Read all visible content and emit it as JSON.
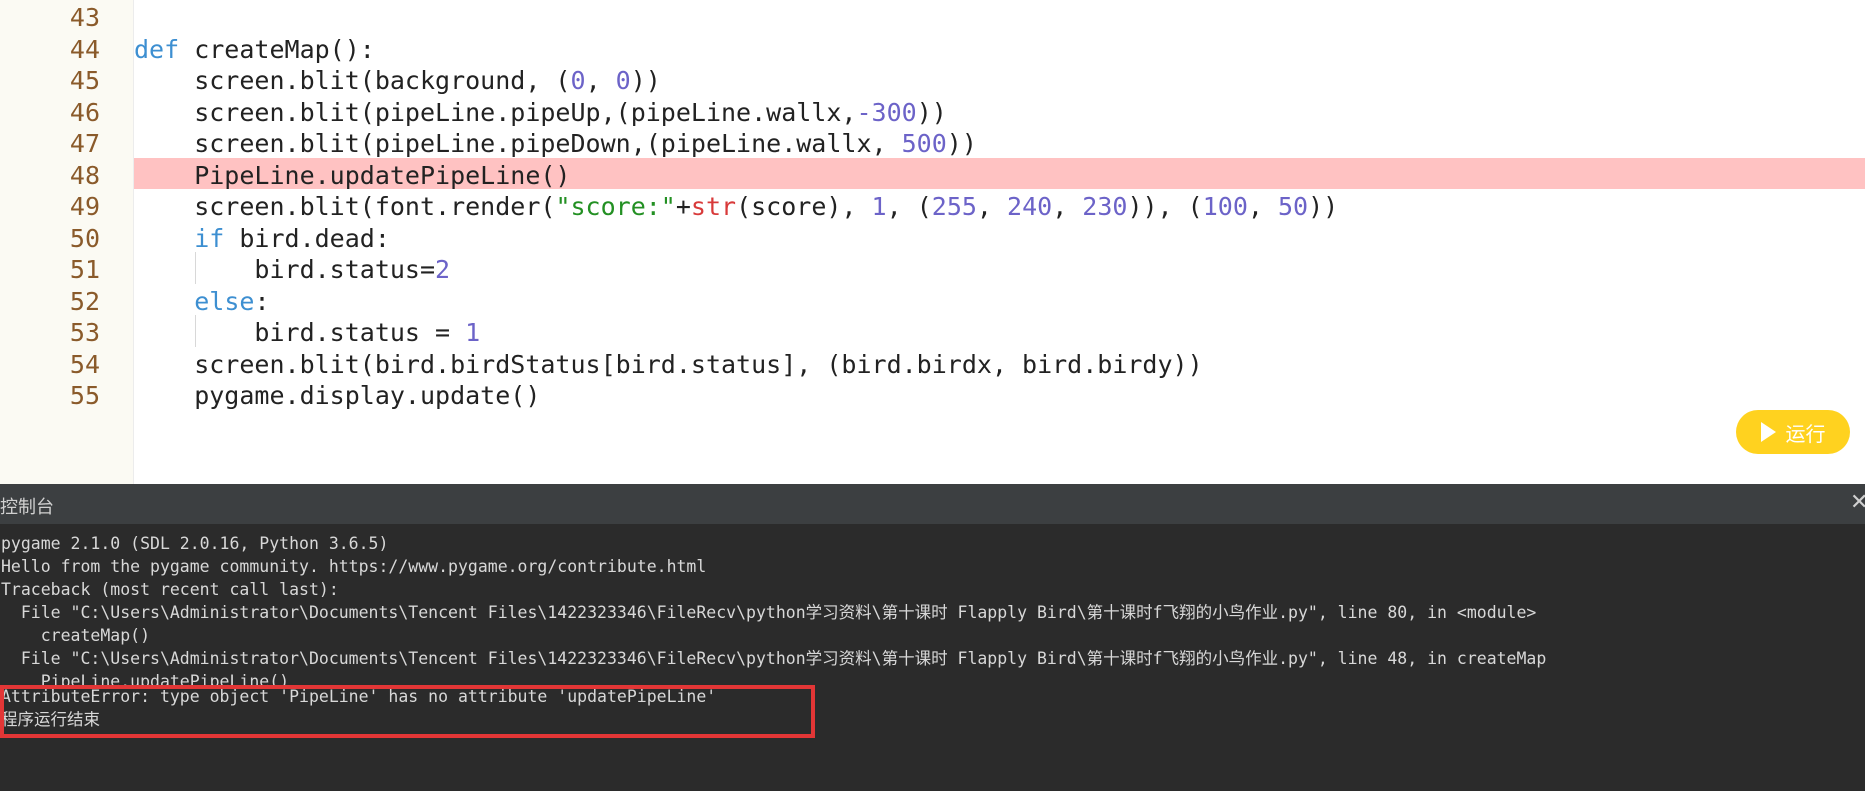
{
  "editor": {
    "lines": [
      {
        "num": "43",
        "html": ""
      },
      {
        "num": "44",
        "html": "<span class=\"kw\">def</span> createMap():"
      },
      {
        "num": "45",
        "html": "    screen.blit(background, (<span class=\"num\">0</span>, <span class=\"num\">0</span>))"
      },
      {
        "num": "46",
        "html": "    screen.blit(pipeLine.pipeUp,(pipeLine.wallx,<span class=\"num\">-300</span>))"
      },
      {
        "num": "47",
        "html": "    screen.blit(pipeLine.pipeDown,(pipeLine.wallx, <span class=\"num\">500</span>))"
      },
      {
        "num": "48",
        "html": "    PipeLine.updatePipeLine()"
      },
      {
        "num": "49",
        "html": "    screen.blit(font.render(<span class=\"str\">\"score:\"</span>+<span class=\"bi\">str</span>(score), <span class=\"num\">1</span>, (<span class=\"num\">255</span>, <span class=\"num\">240</span>, <span class=\"num\">230</span>)), (<span class=\"num\">100</span>, <span class=\"num\">50</span>))"
      },
      {
        "num": "50",
        "html": "    <span class=\"kw\">if</span> bird.dead:"
      },
      {
        "num": "51",
        "html": "        bird.status=<span class=\"num\">2</span>"
      },
      {
        "num": "52",
        "html": "    <span class=\"kw\">else</span>:"
      },
      {
        "num": "53",
        "html": "        bird.status = <span class=\"num\">1</span>"
      },
      {
        "num": "54",
        "html": "    screen.blit(bird.birdStatus[bird.status], (bird.birdx, bird.birdy))"
      },
      {
        "num": "55",
        "html": "    pygame.display.update()"
      }
    ],
    "highlighted_line": "48"
  },
  "run_button": {
    "label": "运行"
  },
  "console": {
    "title": "控制台",
    "close_label": "✕",
    "lines": [
      "pygame 2.1.0 (SDL 2.0.16, Python 3.6.5)",
      "Hello from the pygame community. https://www.pygame.org/contribute.html",
      "Traceback (most recent call last):",
      "  File \"C:\\Users\\Administrator\\Documents\\Tencent Files\\1422323346\\FileRecv\\python学习资料\\第十课时 Flapply Bird\\第十课时f飞翔的小鸟作业.py\", line 80, in <module>",
      "    createMap()",
      "  File \"C:\\Users\\Administrator\\Documents\\Tencent Files\\1422323346\\FileRecv\\python学习资料\\第十课时 Flapply Bird\\第十课时f飞翔的小鸟作业.py\", line 48, in createMap",
      "    PipeLine.updatePipeLine()",
      "AttributeError: type object 'PipeLine' has no attribute 'updatePipeLine'",
      "程序运行结束"
    ]
  },
  "colors": {
    "keyword": "#3d8fd1",
    "number": "#6c63c8",
    "string": "#239023",
    "builtin": "#d83a3a",
    "highlight": "#ffc2c2",
    "run_button": "#ffd21f",
    "error_box": "#e23636"
  }
}
